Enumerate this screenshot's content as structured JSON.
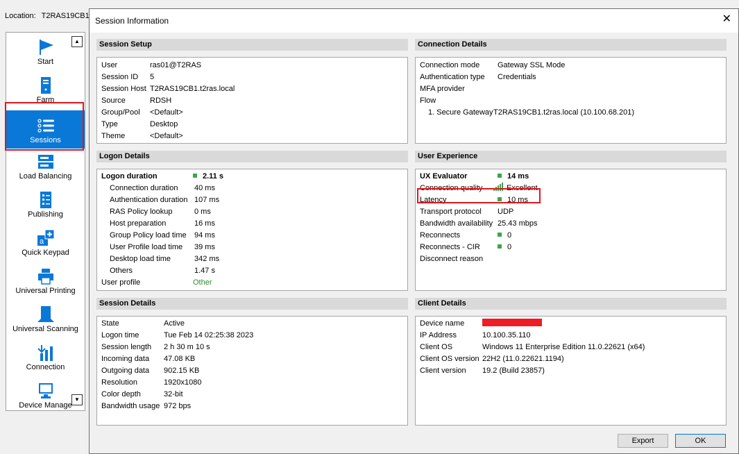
{
  "location": {
    "label": "Location:",
    "value": "T2RAS19CB1"
  },
  "nav": {
    "items": [
      {
        "label": "Start",
        "icon": "start-flag-icon"
      },
      {
        "label": "Farm",
        "icon": "farm-icon"
      },
      {
        "label": "Sessions",
        "icon": "sessions-icon",
        "active": true
      },
      {
        "label": "Load Balancing",
        "icon": "load-balancing-icon"
      },
      {
        "label": "Publishing",
        "icon": "publishing-icon"
      },
      {
        "label": "Quick Keypad",
        "icon": "quick-keypad-icon"
      },
      {
        "label": "Universal Printing",
        "icon": "printer-icon"
      },
      {
        "label": "Universal Scanning",
        "icon": "scanner-icon"
      },
      {
        "label": "Connection",
        "icon": "connection-icon"
      },
      {
        "label": "Device Manage",
        "icon": "device-manager-icon"
      }
    ],
    "scroll_up": "▲",
    "scroll_down": "▼"
  },
  "dialog": {
    "title": "Session Information",
    "close": "✕",
    "session_setup": {
      "header": "Session Setup",
      "rows": [
        {
          "k": "User",
          "v": "ras01@T2RAS"
        },
        {
          "k": "Session ID",
          "v": "5"
        },
        {
          "k": "Session Host",
          "v": "T2RAS19CB1.t2ras.local"
        },
        {
          "k": "Source",
          "v": "RDSH"
        },
        {
          "k": "Group/Pool",
          "v": "<Default>"
        },
        {
          "k": "Type",
          "v": "Desktop"
        },
        {
          "k": "Theme",
          "v": "<Default>"
        }
      ]
    },
    "connection_details": {
      "header": "Connection Details",
      "rows": [
        {
          "k": "Connection mode",
          "v": "Gateway SSL Mode"
        },
        {
          "k": "Authentication type",
          "v": "Credentials"
        },
        {
          "k": "MFA provider",
          "v": ""
        },
        {
          "k": "Flow",
          "v": ""
        },
        {
          "k": "1. Secure Gateway",
          "v": "T2RAS19CB1.t2ras.local (10.100.68.201)"
        }
      ]
    },
    "logon_details": {
      "header": "Logon Details",
      "duration_label": "Logon duration",
      "duration_value": "2.11 s",
      "rows": [
        {
          "k": "Connection duration",
          "v": "40 ms"
        },
        {
          "k": "Authentication duration",
          "v": "107 ms"
        },
        {
          "k": "RAS Policy lookup",
          "v": "0 ms"
        },
        {
          "k": "Host preparation",
          "v": "16 ms"
        },
        {
          "k": "Group Policy load time",
          "v": "94 ms"
        },
        {
          "k": "User Profile load time",
          "v": "39 ms"
        },
        {
          "k": "Desktop load time",
          "v": "342 ms"
        },
        {
          "k": "Others",
          "v": "1.47 s"
        }
      ],
      "profile_label": "User profile",
      "profile_value": "Other"
    },
    "user_experience": {
      "header": "User Experience",
      "rows": [
        {
          "k": "UX Evaluator",
          "v": "14 ms",
          "dot": true,
          "bold": true
        },
        {
          "k": "Connection quality",
          "v": "Excellent",
          "signal": true
        },
        {
          "k": "Latency",
          "v": "10 ms",
          "dot": true
        },
        {
          "k": "Transport protocol",
          "v": "UDP"
        },
        {
          "k": "Bandwidth availability",
          "v": "25.43 mbps"
        },
        {
          "k": "Reconnects",
          "v": "0",
          "dot": true
        },
        {
          "k": "Reconnects - CIR",
          "v": "0",
          "dot": true
        },
        {
          "k": "Disconnect reason",
          "v": ""
        }
      ]
    },
    "session_details": {
      "header": "Session Details",
      "rows": [
        {
          "k": "State",
          "v": "Active"
        },
        {
          "k": "Logon time",
          "v": "Tue Feb 14 02:25:38 2023"
        },
        {
          "k": "Session length",
          "v": "2 h 30 m 10 s"
        },
        {
          "k": "Incoming data",
          "v": "47.08 KB"
        },
        {
          "k": "Outgoing data",
          "v": "902.15 KB"
        },
        {
          "k": "Resolution",
          "v": "1920x1080"
        },
        {
          "k": "Color depth",
          "v": "32-bit"
        },
        {
          "k": "Bandwidth usage",
          "v": "972 bps"
        }
      ]
    },
    "client_details": {
      "header": "Client Details",
      "rows": [
        {
          "k": "Device name",
          "v": ""
        },
        {
          "k": "IP Address",
          "v": "10.100.35.110"
        },
        {
          "k": "Client OS",
          "v": "Windows 11 Enterprise Edition 11.0.22621 (x64)"
        },
        {
          "k": "Client OS version",
          "v": "22H2 (11.0.22621.1194)"
        },
        {
          "k": "Client version",
          "v": "19.2 (Build 23857)"
        }
      ]
    },
    "buttons": {
      "export": "Export",
      "ok": "OK"
    }
  },
  "colors": {
    "accent": "#0a78d7",
    "status_green": "#3fa34d",
    "highlight_red": "#e0161c"
  }
}
